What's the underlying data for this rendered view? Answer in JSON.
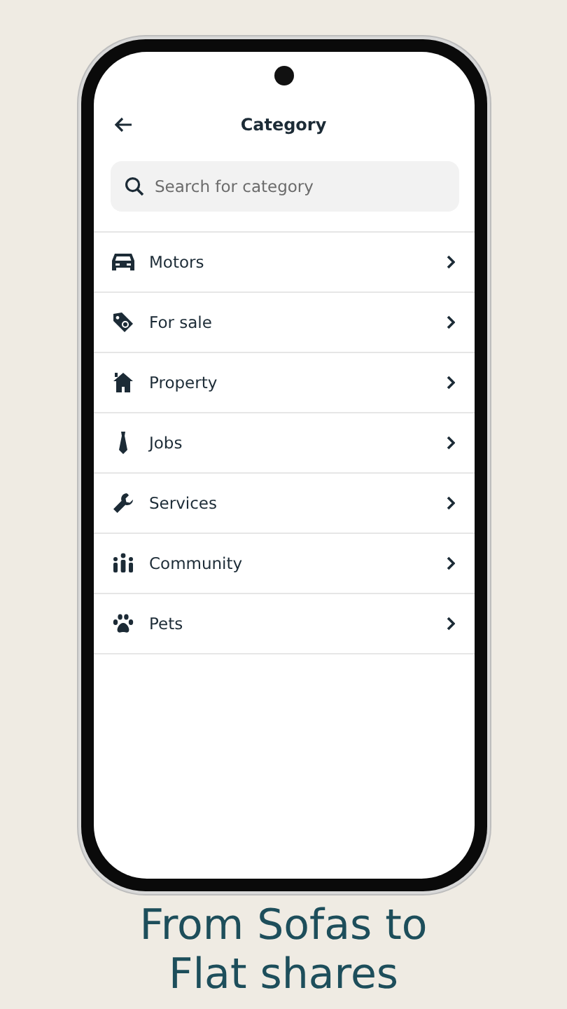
{
  "header": {
    "title": "Category"
  },
  "search": {
    "placeholder": "Search for category"
  },
  "categories": [
    {
      "label": "Motors"
    },
    {
      "label": "For sale"
    },
    {
      "label": "Property"
    },
    {
      "label": "Jobs"
    },
    {
      "label": "Services"
    },
    {
      "label": "Community"
    },
    {
      "label": "Pets"
    }
  ],
  "caption": [
    "From Sofas to",
    "Flat shares"
  ]
}
